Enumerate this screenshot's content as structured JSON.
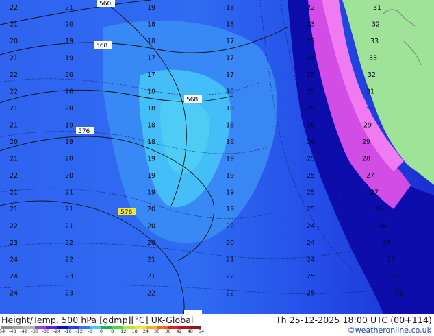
{
  "header": {
    "product_label": "Height/Temp. 500 hPa [gdmp][°C] UK-Global",
    "valid_time": "Th 25-12-2025 18:00 UTC (00+114)",
    "credit": "©weatheronline.co.uk"
  },
  "colors": {
    "ocean_deep": "#1c2fd8",
    "blue_mid": "#2f6cf2",
    "blue_light": "#3f9af6",
    "cyan": "#46c8f8",
    "navy": "#0d0dab",
    "magenta": "#d24de6",
    "pink": "#f07af2",
    "land": "#9ee398"
  },
  "height_contours": [
    "560",
    "568",
    "568",
    "576",
    "576",
    "568"
  ],
  "temperature_labels": {
    "far_west": [
      "22",
      "21",
      "20",
      "21",
      "22",
      "22",
      "21",
      "21",
      "20",
      "21",
      "22",
      "21",
      "21",
      "22",
      "23",
      "24",
      "24",
      "24"
    ],
    "west": [
      "21",
      "20",
      "19",
      "19",
      "20",
      "20",
      "20",
      "19",
      "19",
      "20",
      "20",
      "21",
      "21",
      "21",
      "22",
      "22",
      "23",
      "23"
    ],
    "center": [
      "19",
      "18",
      "18",
      "17",
      "17",
      "18",
      "18",
      "18",
      "18",
      "19",
      "19",
      "19",
      "20",
      "20",
      "20",
      "21",
      "21",
      "22"
    ],
    "east": [
      "18",
      "18",
      "17",
      "17",
      "17",
      "18",
      "18",
      "18",
      "18",
      "19",
      "19",
      "19",
      "19",
      "20",
      "20",
      "21",
      "22",
      "22"
    ],
    "far_east": [
      "22",
      "23",
      "23",
      "24",
      "25",
      "25",
      "25",
      "26",
      "26",
      "25",
      "25",
      "25",
      "25",
      "24",
      "24",
      "24",
      "25",
      "25"
    ],
    "coast": [
      "31",
      "32",
      "33",
      "33",
      "32",
      "31",
      "30",
      "29",
      "29",
      "28",
      "27",
      "27",
      "26",
      "26",
      "26",
      "27",
      "26",
      "26"
    ]
  },
  "legend": {
    "values": [
      "-54",
      "-48",
      "-42",
      "-38",
      "-30",
      "-24",
      "-18",
      "-12",
      "-8",
      "0",
      "8",
      "12",
      "18",
      "24",
      "30",
      "36",
      "42",
      "48",
      "54"
    ],
    "colors": [
      "#8a8a8a",
      "#a1a1a1",
      "#b7b7b7",
      "#9c3fd8",
      "#5c1de0",
      "#1010b8",
      "#1f3fe8",
      "#2f7af5",
      "#48c8f8",
      "#20b05a",
      "#4fd64b",
      "#b9e33a",
      "#f1e536",
      "#f0b02c",
      "#ea6a22",
      "#d9261b",
      "#b4142c",
      "#8c1818"
    ]
  }
}
